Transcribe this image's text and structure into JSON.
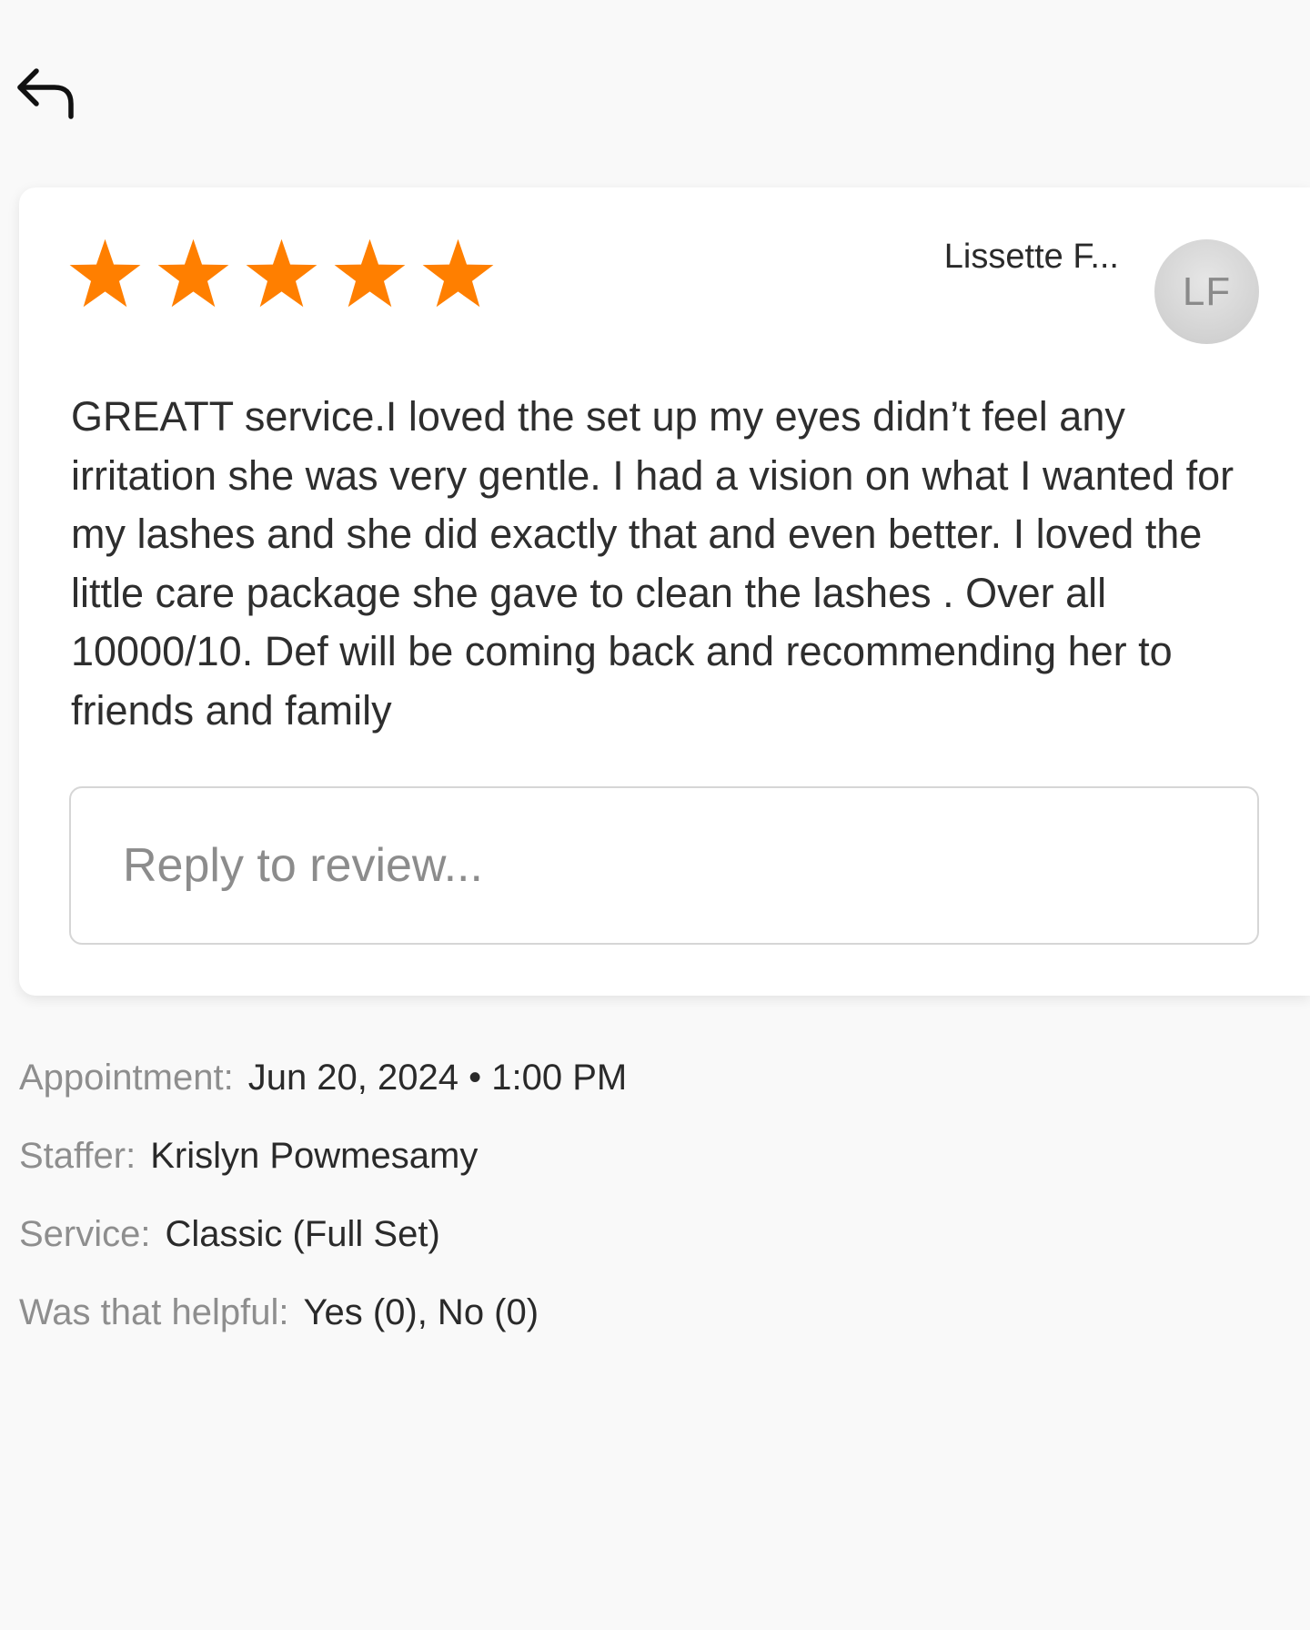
{
  "header": {
    "back_icon": "reply-arrow-icon"
  },
  "review": {
    "rating": 5,
    "max_rating": 5,
    "star_color": "#ff7f00",
    "reviewer_name": "Lissette F...",
    "avatar_initials": "LF",
    "text": "GREATT service.I loved the set up my eyes didn’t feel any irritation she was very gentle. I had a vision on what I wanted for my lashes and she did exactly that and even better. I loved the little care package she gave to clean the lashes . Over all 10000/10. Def will be coming back and recommending her to friends and family",
    "reply_placeholder": "Reply to review..."
  },
  "details": {
    "appointment_label": "Appointment:",
    "appointment_value": "Jun 20, 2024 • 1:00 PM",
    "staffer_label": "Staffer:",
    "staffer_value": "Krislyn Powmesamy",
    "service_label": "Service:",
    "service_value": "Classic (Full Set)",
    "helpful_label": "Was that helpful:",
    "helpful_value": "Yes (0), No (0)"
  }
}
